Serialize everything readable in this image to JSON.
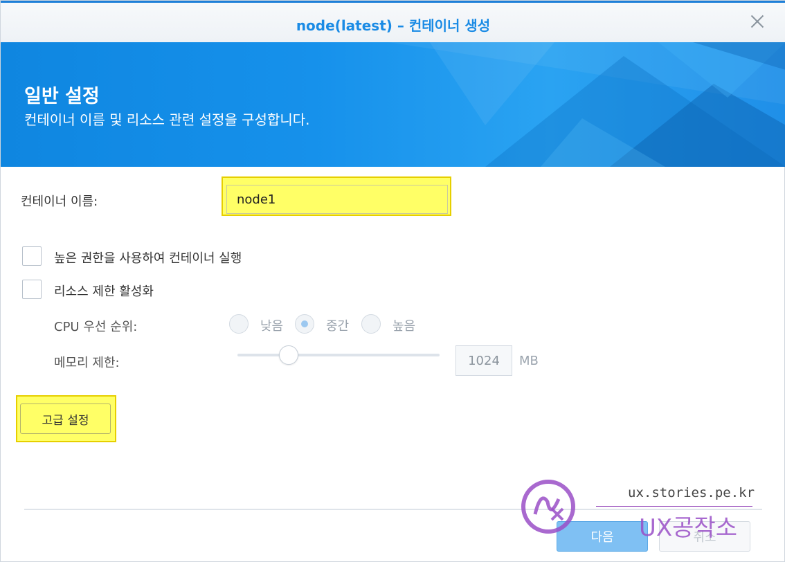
{
  "window": {
    "title": "node(latest) – 컨테이너 생성"
  },
  "banner": {
    "title": "일반 설정",
    "subtitle": "컨테이너 이름 및 리소스 관련 설정을 구성합니다."
  },
  "form": {
    "container_name_label": "컨테이너 이름:",
    "container_name_value": "node1",
    "privileged_label": "높은 권한을 사용하여 컨테이너 실행",
    "privileged_checked": false,
    "resource_limit_label": "리소스 제한 활성화",
    "resource_limit_checked": false,
    "cpu_priority_label": "CPU 우선 순위:",
    "cpu_options": [
      "낮음",
      "중간",
      "높음"
    ],
    "cpu_selected": "중간",
    "memory_limit_label": "메모리 제한:",
    "memory_value": "1024",
    "memory_unit": "MB",
    "advanced_button": "고급 설정"
  },
  "footer": {
    "next_button": "다음",
    "cancel_button": "취소"
  },
  "watermark": {
    "url": "ux.stories.pe.kr",
    "brand": "UX공작소"
  },
  "colors": {
    "accent": "#1a8be5",
    "banner": "#1691eb",
    "highlight": "#ffff66"
  }
}
